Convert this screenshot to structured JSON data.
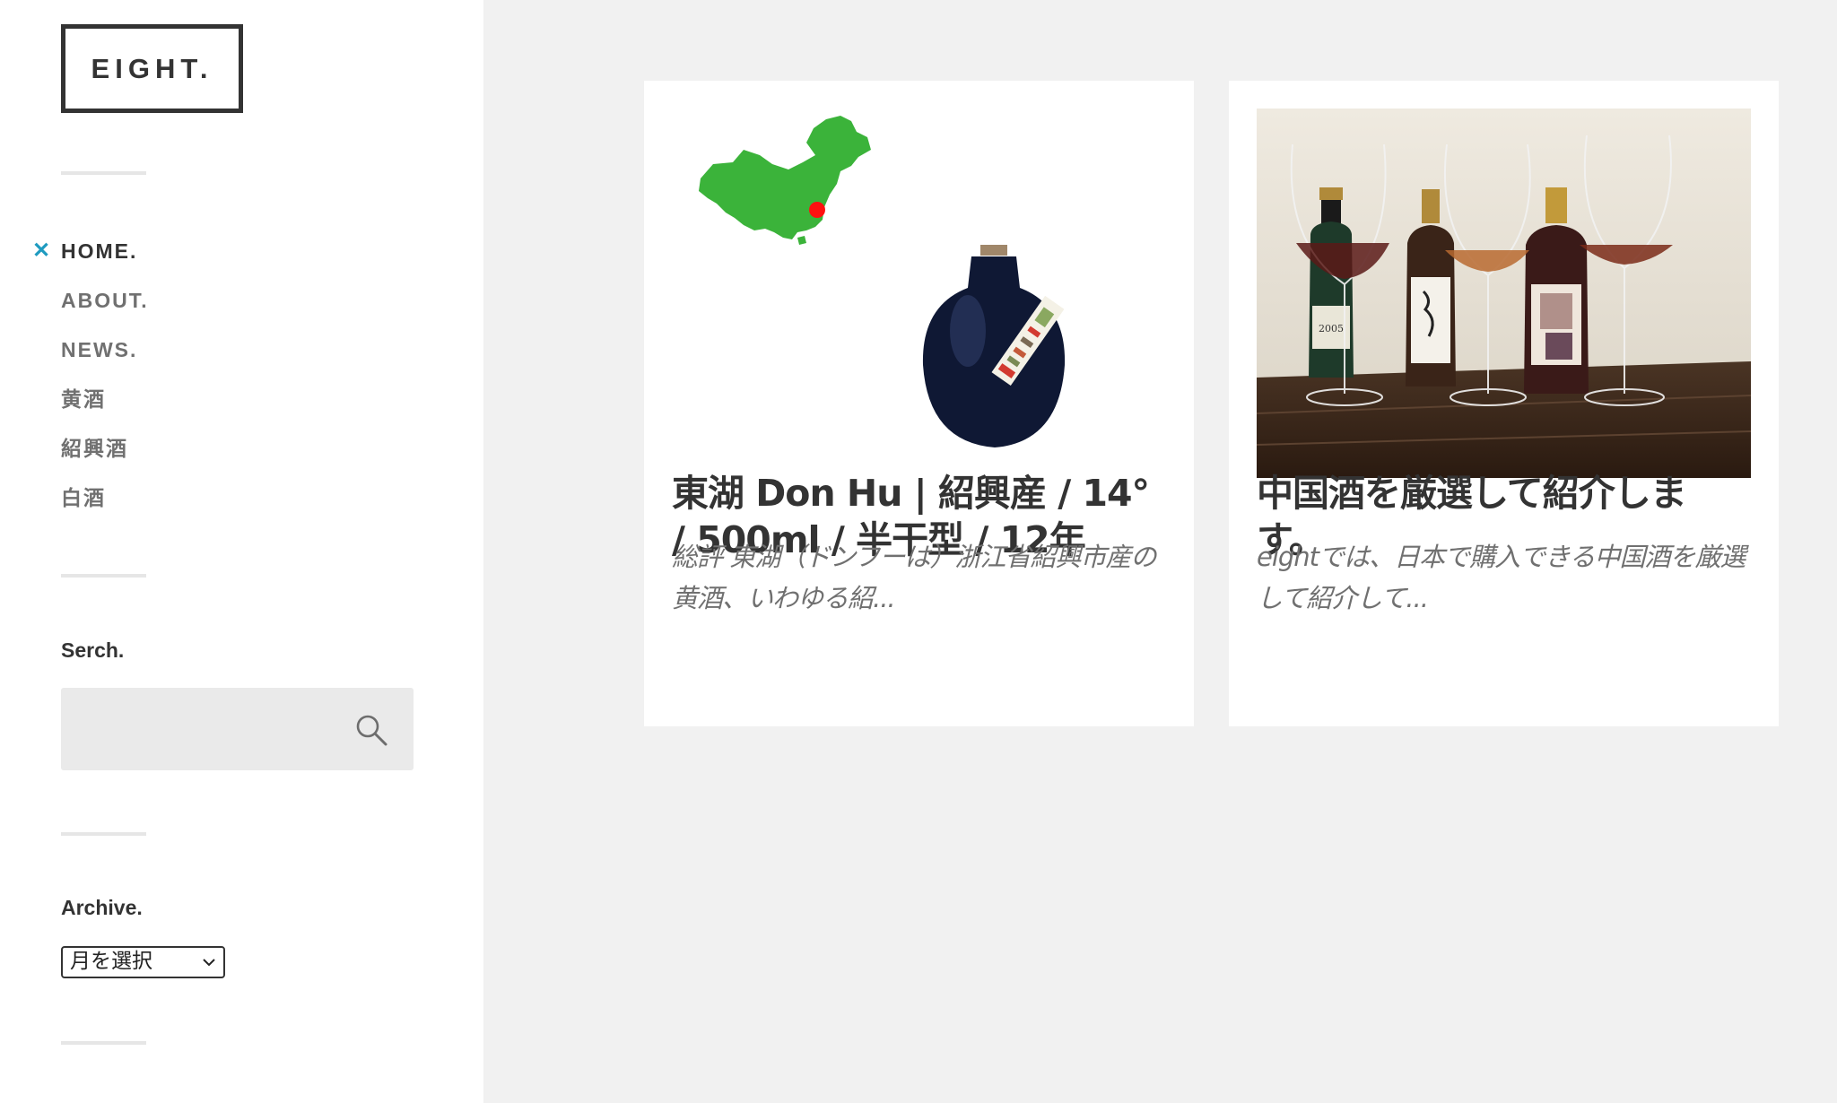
{
  "site": {
    "logo": "EIGHT."
  },
  "nav": {
    "items": [
      {
        "label": "HOME.",
        "current": true
      },
      {
        "label": "ABOUT."
      },
      {
        "label": "NEWS."
      },
      {
        "label": "黄酒"
      },
      {
        "label": "紹興酒"
      },
      {
        "label": "白酒"
      }
    ]
  },
  "search": {
    "title": "Serch.",
    "value": "",
    "icon": "search-icon"
  },
  "archive": {
    "title": "Archive.",
    "selected": "月を選択"
  },
  "posts": [
    {
      "title": "東湖 Don Hu | 紹興産 / 14° / 500ml / 半干型 / 12年",
      "excerpt": "総評 東湖（ドンフーは）浙江省紹興市産の黄酒、いわゆる紹...",
      "image": "china-map-and-bottle"
    },
    {
      "title": "中国酒を厳選して紹介します。",
      "excerpt": "eightでは、日本で購入できる中国酒を厳選して紹介して...",
      "image": "bottles-and-wine-glasses-photo",
      "bottle_label": "2005"
    }
  ],
  "colors": {
    "accent": "#1f9bc0",
    "map_green": "#3bb33a",
    "marker_red": "#ff1010",
    "bottle_navy": "#0f1834"
  }
}
